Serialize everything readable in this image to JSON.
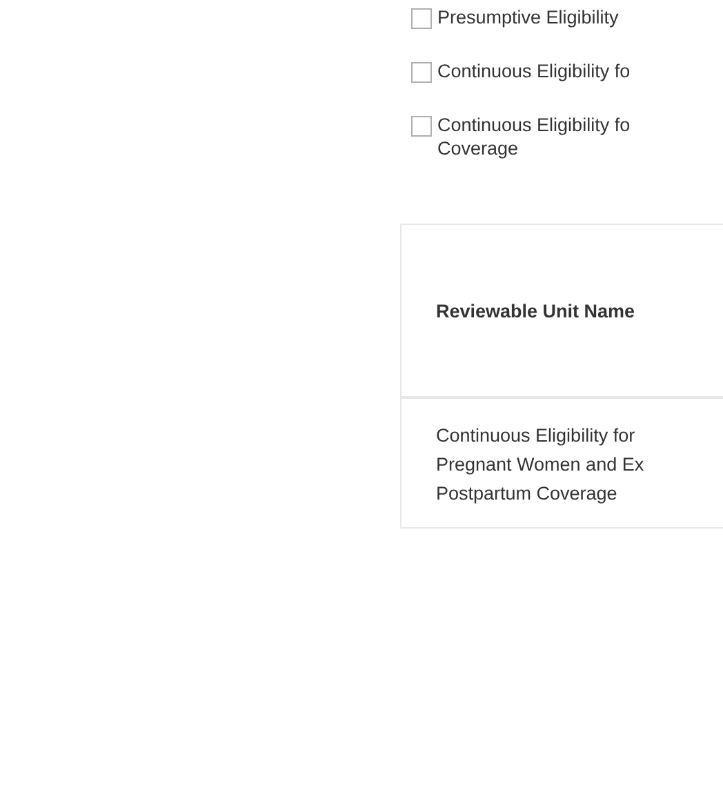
{
  "options": [
    {
      "lines": [
        "Presumptive Eligibility"
      ],
      "checked": false
    },
    {
      "lines": [
        "Continuous Eligibility fo"
      ],
      "checked": false
    },
    {
      "lines": [
        "Continuous Eligibility fo",
        "Coverage"
      ],
      "checked": false
    }
  ],
  "table": {
    "columns": [
      "Reviewable Unit Name"
    ],
    "rows": [
      {
        "lines": [
          "Continuous Eligibility for",
          "Pregnant Women and Ex",
          "Postpartum Coverage"
        ]
      }
    ]
  }
}
